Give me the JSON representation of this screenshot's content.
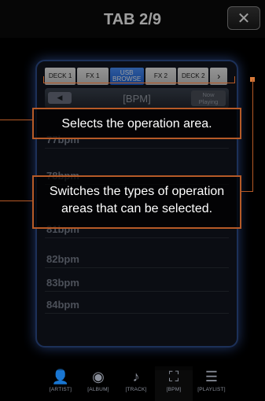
{
  "header": {
    "title": "TAB 2/9",
    "close_icon": "close-icon"
  },
  "tabs": [
    {
      "label": "DECK 1"
    },
    {
      "label": "FX 1"
    },
    {
      "label": "USB\nBROWSE"
    },
    {
      "label": "FX 2"
    },
    {
      "label": "DECK 2"
    },
    {
      "label": "›"
    }
  ],
  "nav": {
    "title": "[BPM]",
    "now_playing": "Now\nPlaying",
    "back_icon": "back-arrow-icon"
  },
  "list": {
    "items": [
      "77bpm",
      "78bpm",
      "81bpm",
      "82bpm",
      "83bpm",
      "84bpm"
    ]
  },
  "bottombar": {
    "items": [
      {
        "label": "[ARTIST]",
        "icon": "person-icon",
        "glyph": "👤"
      },
      {
        "label": "[ALBUM]",
        "icon": "album-icon",
        "glyph": "◉"
      },
      {
        "label": "[TRACK]",
        "icon": "music-note-icon",
        "glyph": "♪"
      },
      {
        "label": "[BPM]",
        "icon": "metronome-icon",
        "glyph": "⛶"
      },
      {
        "label": "[PLAYLIST]",
        "icon": "list-icon",
        "glyph": "☰"
      }
    ]
  },
  "callouts": {
    "operation_area": "Selects the operation area.",
    "types_switch": "Switches the types of operation areas that can be selected."
  },
  "colors": {
    "accent": "#d77a3a",
    "glow": "#568aff"
  }
}
